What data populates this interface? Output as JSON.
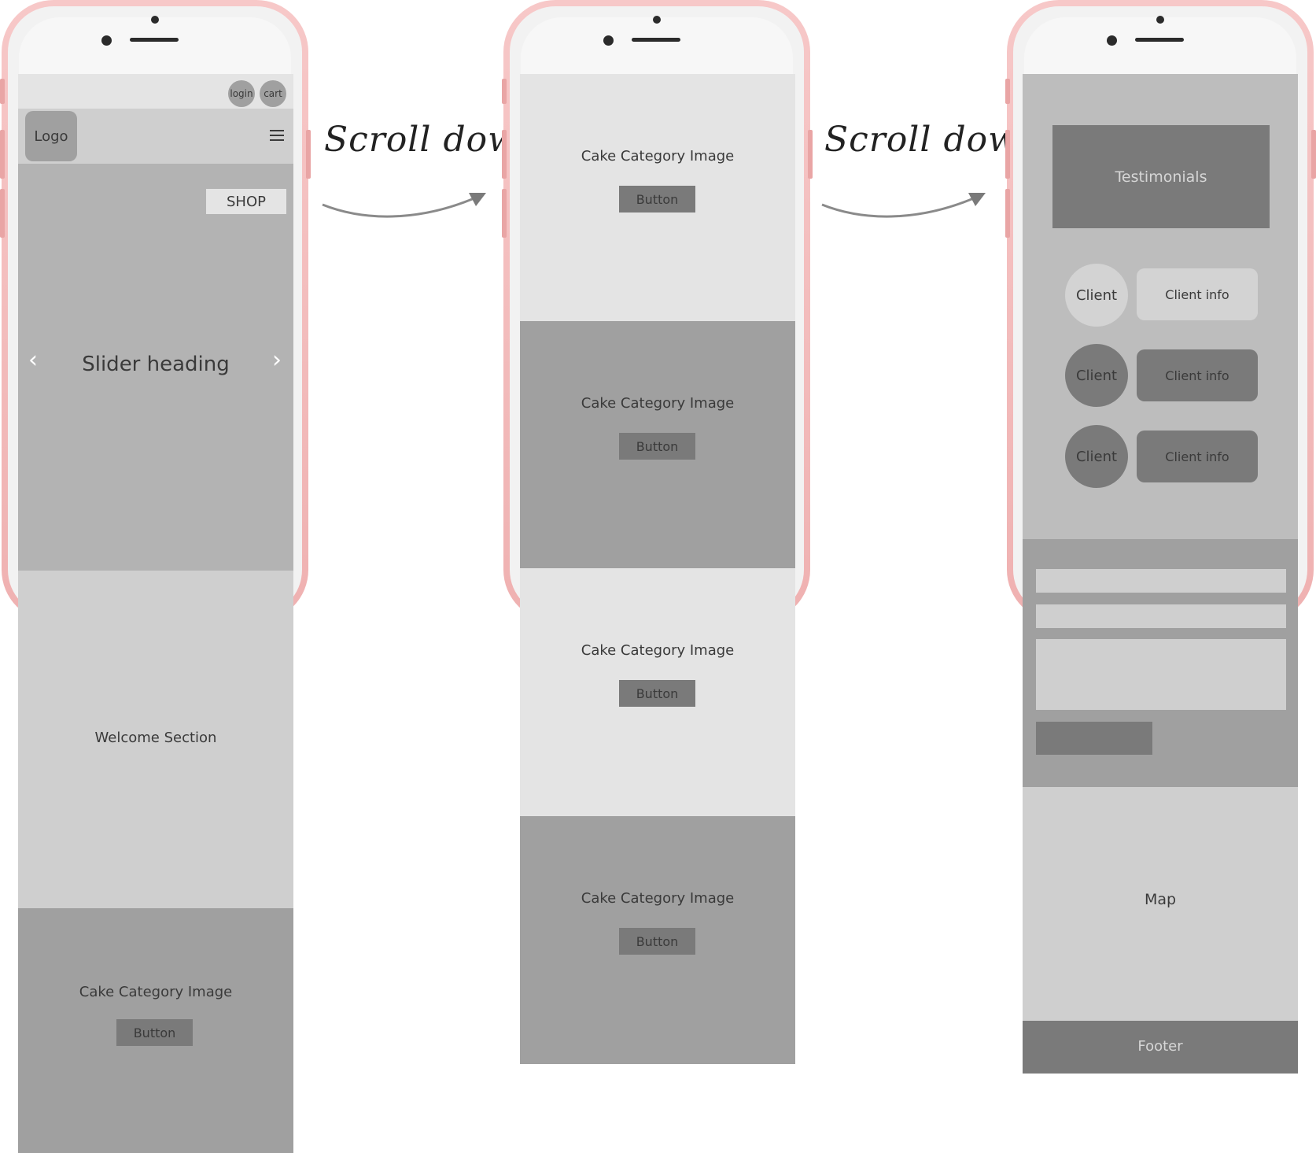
{
  "phone1": {
    "top_buttons": [
      "login",
      "cart"
    ],
    "logo": "Logo",
    "shop": "SHOP",
    "slider_heading": "Slider heading",
    "prev": "‹",
    "next": "›",
    "welcome": "Welcome Section",
    "category": {
      "label": "Cake Category Image",
      "button": "Button"
    }
  },
  "arrow1": {
    "text": "Scroll down"
  },
  "phone2": {
    "categories": [
      {
        "label": "Cake Category Image",
        "button": "Button"
      },
      {
        "label": "Cake Category Image",
        "button": "Button"
      },
      {
        "label": "Cake Category Image",
        "button": "Button"
      },
      {
        "label": "Cake Category Image",
        "button": "Button"
      }
    ]
  },
  "arrow2": {
    "text": "Scroll down"
  },
  "phone3": {
    "testimonials": "Testimonials",
    "clients": [
      {
        "client": "Client",
        "info": "Client info"
      },
      {
        "client": "Client",
        "info": "Client info"
      },
      {
        "client": "Client",
        "info": "Client info"
      }
    ],
    "map": "Map",
    "footer": "Footer"
  },
  "colors": {
    "frame_pink": "#f2b8b8",
    "light_gray": "#e4e4e4",
    "mid_gray": "#cfcfcf",
    "gray": "#b3b3b3",
    "darker_gray": "#a0a0a0",
    "dark_gray": "#7a7a7a"
  }
}
